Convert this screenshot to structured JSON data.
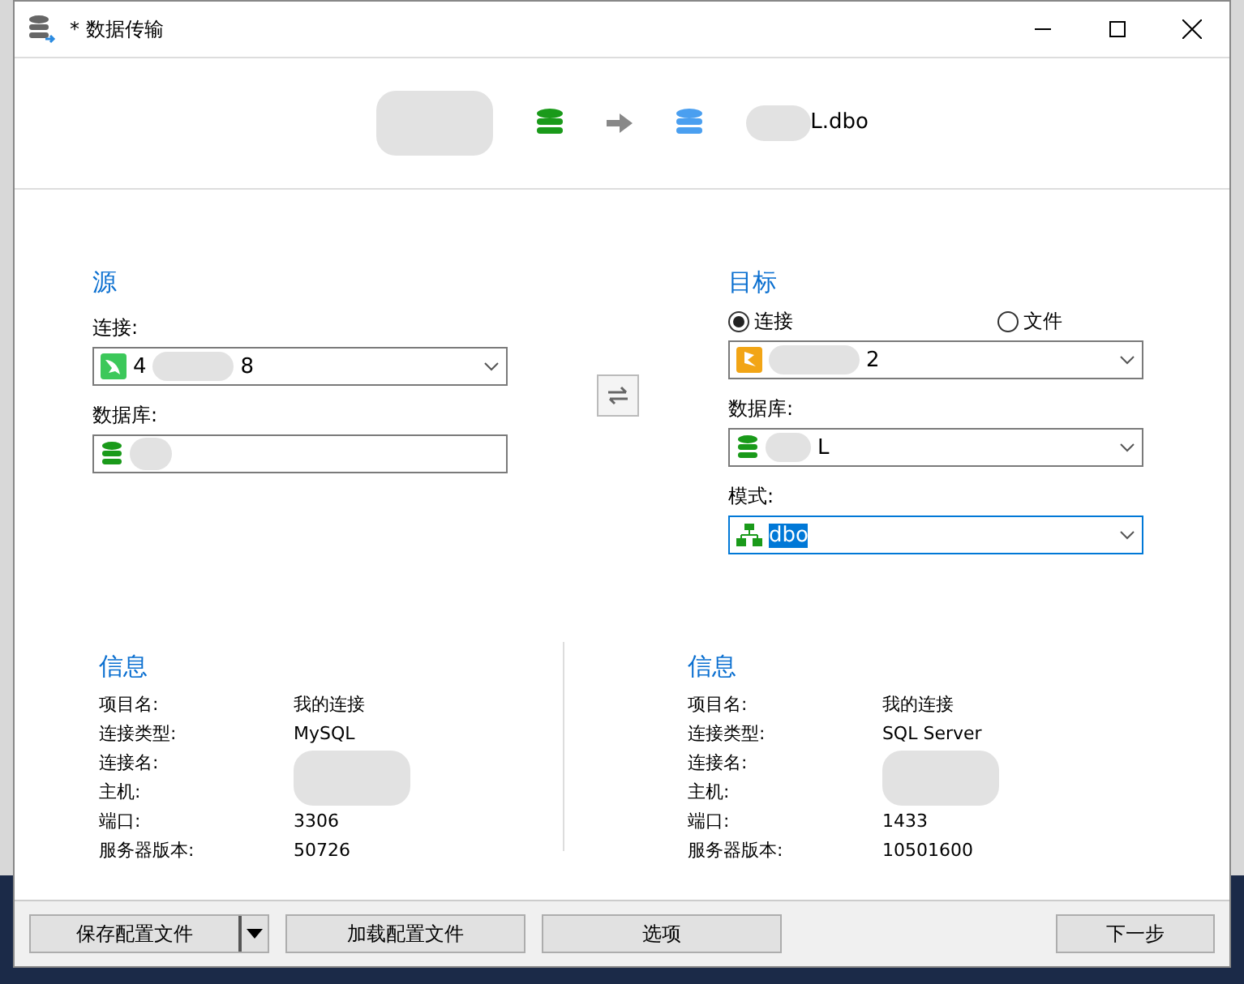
{
  "window": {
    "title": "* 数据传输"
  },
  "header": {
    "target_label": "L.dbo"
  },
  "source": {
    "heading": "源",
    "connection_label": "连接:",
    "connection_parts": [
      "4",
      "8"
    ],
    "database_label": "数据库:"
  },
  "target": {
    "heading": "目标",
    "radios": [
      {
        "label": "连接",
        "selected": true
      },
      {
        "label": "文件",
        "selected": false
      }
    ],
    "connection_parts": [
      "2"
    ],
    "database_label": "数据库:",
    "database_parts": [
      "L"
    ],
    "schema_label": "模式:",
    "schema_value": "dbo",
    "schema_focused": true
  },
  "info": [
    {
      "heading": "信息",
      "rows": [
        {
          "label": "项目名:",
          "value": "我的连接"
        },
        {
          "label": "连接类型:",
          "value": "MySQL"
        },
        {
          "label": "连接名:",
          "value": ""
        },
        {
          "label": "主机:",
          "value": ""
        },
        {
          "label": "端口:",
          "value": "3306"
        },
        {
          "label": "服务器版本:",
          "value": "50726"
        }
      ]
    },
    {
      "heading": "信息",
      "rows": [
        {
          "label": "项目名:",
          "value": "我的连接"
        },
        {
          "label": "连接类型:",
          "value": "SQL Server"
        },
        {
          "label": "连接名:",
          "value": ""
        },
        {
          "label": "主机:",
          "value": ""
        },
        {
          "label": "端口:",
          "value": "1433"
        },
        {
          "label": "服务器版本:",
          "value": "10501600"
        }
      ]
    }
  ],
  "footer": {
    "buttons": [
      {
        "label": "保存配置文件",
        "kind": "split"
      },
      {
        "label": "加载配置文件",
        "kind": "plain"
      },
      {
        "label": "选项",
        "kind": "plain"
      }
    ],
    "next": "下一步"
  }
}
